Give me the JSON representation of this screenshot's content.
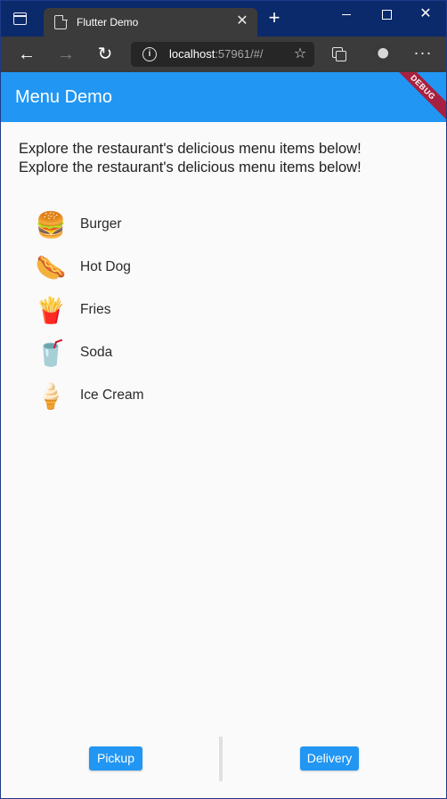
{
  "browser": {
    "tab_title": "Flutter Demo",
    "tab_close": "✕",
    "new_tab": "+",
    "win_close": "✕",
    "url_host": "localhost",
    "url_rest": ":57961/#/",
    "nav_back": "←",
    "nav_forward": "→",
    "nav_reload": "↻",
    "more": "···"
  },
  "app": {
    "title": "Menu Demo",
    "debug_banner": "DEBUG",
    "intro_line1": "Explore the restaurant's delicious menu items below!",
    "intro_line2": "Explore the restaurant's delicious menu items below!",
    "menu_items": [
      {
        "emoji": "🍔",
        "label": "Burger"
      },
      {
        "emoji": "🌭",
        "label": "Hot Dog"
      },
      {
        "emoji": "🍟",
        "label": "Fries"
      },
      {
        "emoji": "🥤",
        "label": "Soda"
      },
      {
        "emoji": "🍦",
        "label": "Ice Cream"
      }
    ],
    "buttons": {
      "pickup": "Pickup",
      "delivery": "Delivery"
    }
  },
  "colors": {
    "accent": "#2196f3",
    "titlebar": "#0b2a6b",
    "toolbar": "#3b3b3b",
    "debug": "#a8203f"
  }
}
